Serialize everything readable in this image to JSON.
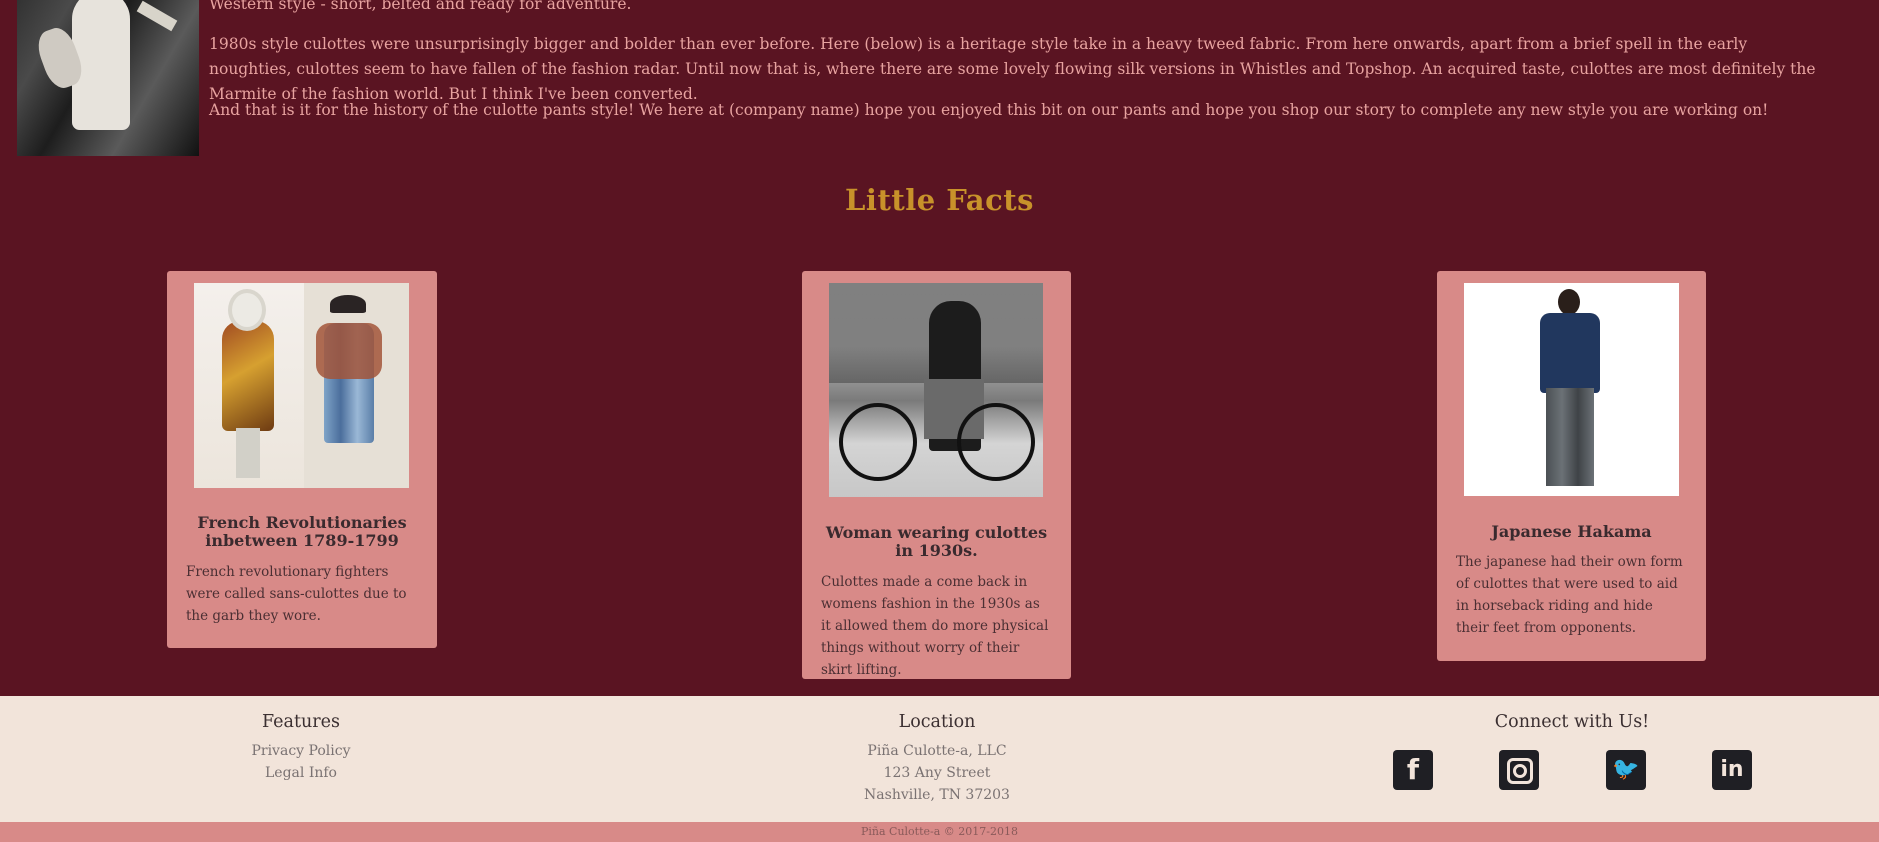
{
  "history": {
    "p1": "Western style - short, belted and ready for adventure.",
    "p2": "1980s style culottes were unsurprisingly bigger and bolder than ever before. Here (below) is a heritage style take in a heavy tweed fabric. From here onwards, apart from a brief spell in the early noughties, culottes seem to have fallen of the fashion radar. Until now that is, where there are some lovely flowing silk versions in Whistles and Topshop. An acquired taste, culottes are most definitely the Marmite of the fashion world. But I think I've been converted.",
    "p3": "And that is it for the history of the culotte pants style! We here at (company name) hope you enjoyed this bit on our pants and hope you shop our story to complete any new style you are working on!"
  },
  "facts": {
    "title": "Little Facts",
    "cards": [
      {
        "title": "French Revolutionaries inbetween 1789-1799",
        "desc": "French revolutionary fighters were called sans-culottes due to the garb they wore."
      },
      {
        "title": "Woman wearing culottes in 1930s.",
        "desc": "Culottes made a come back in womens fashion in the 1930s as it allowed them do more physical things without worry of their skirt lifting."
      },
      {
        "title": "Japanese Hakama",
        "desc": "The japanese had their own form of culottes that were used to aid in horseback riding and hide their feet from opponents."
      }
    ]
  },
  "footer": {
    "features": {
      "heading": "Features",
      "links": [
        "Privacy Policy",
        "Legal Info"
      ]
    },
    "location": {
      "heading": "Location",
      "lines": [
        "Piña Culotte-a, LLC",
        "123 Any Street",
        "Nashville, TN 37203"
      ]
    },
    "connect": {
      "heading": "Connect with Us!",
      "icons": [
        "facebook-icon",
        "instagram-icon",
        "twitter-icon",
        "linkedin-icon"
      ],
      "glyphs": {
        "facebook": "f",
        "twitter": "🐦",
        "linkedin": "in"
      }
    },
    "copyright": "Piña Culotte-a © 2017-2018"
  },
  "colors": {
    "background": "#5a1422",
    "accent_title": "#c8922a",
    "card": "#d88a88",
    "footer": "#f2e4da",
    "text_light": "#e8a3a0"
  }
}
